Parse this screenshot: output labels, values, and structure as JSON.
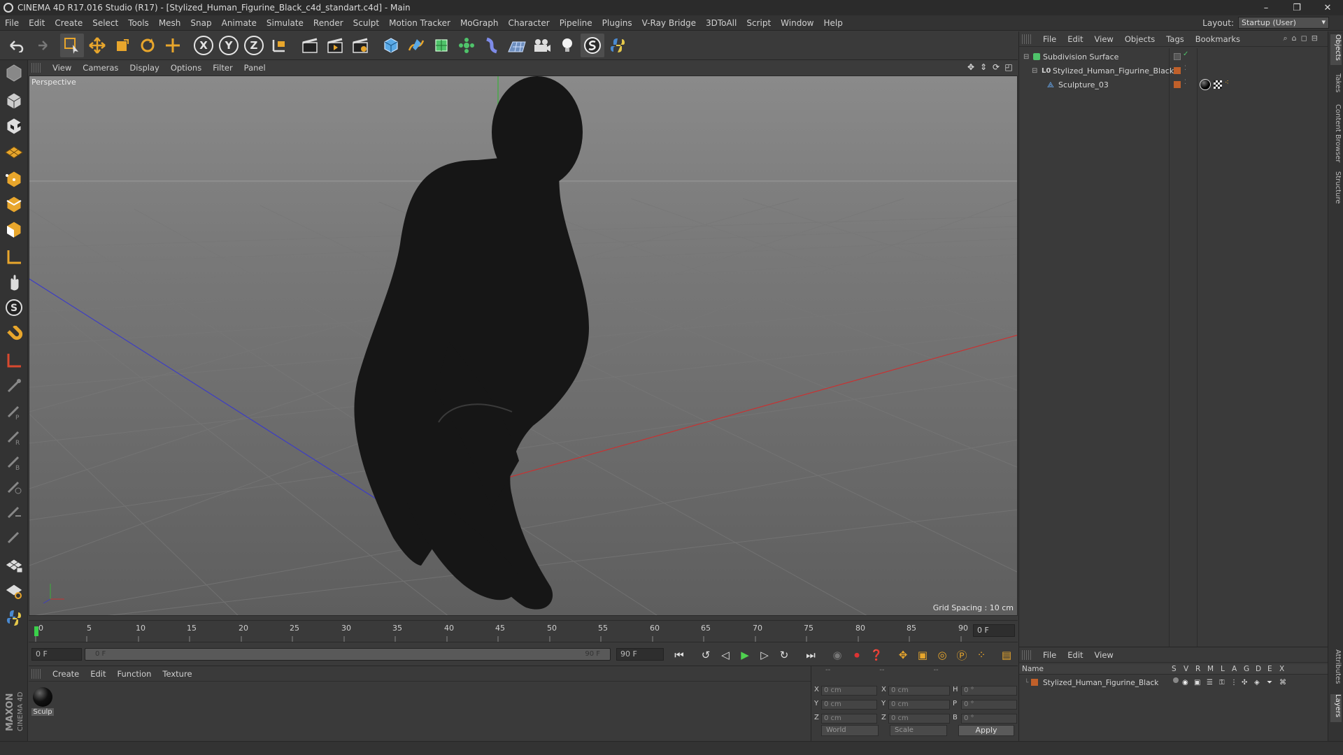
{
  "window": {
    "title": "CINEMA 4D R17.016 Studio (R17) - [Stylized_Human_Figurine_Black_c4d_standart.c4d] - Main",
    "controls": [
      "–",
      "❐",
      "✕"
    ]
  },
  "menubar": {
    "items": [
      "File",
      "Edit",
      "Create",
      "Select",
      "Tools",
      "Mesh",
      "Snap",
      "Animate",
      "Simulate",
      "Render",
      "Sculpt",
      "Motion Tracker",
      "MoGraph",
      "Character",
      "Pipeline",
      "Plugins",
      "V-Ray Bridge",
      "3DToAll",
      "Script",
      "Window",
      "Help"
    ],
    "layout_label": "Layout:",
    "layout_value": "Startup (User)"
  },
  "toolbar": {
    "axis_x": "X",
    "axis_y": "Y",
    "axis_z": "Z"
  },
  "viewport": {
    "menu": [
      "View",
      "Cameras",
      "Display",
      "Options",
      "Filter",
      "Panel"
    ],
    "camera_label": "Perspective",
    "grid_spacing": "Grid Spacing : 10 cm"
  },
  "timeline": {
    "ticks": [
      "0",
      "5",
      "10",
      "15",
      "20",
      "25",
      "30",
      "35",
      "40",
      "45",
      "50",
      "55",
      "60",
      "65",
      "70",
      "75",
      "80",
      "85",
      "90"
    ],
    "current_frame": "0 F"
  },
  "playbar": {
    "start_frame": "0 F",
    "slider_start": "0 F",
    "slider_end": "90 F",
    "end_frame": "90 F"
  },
  "material_panel": {
    "menu": [
      "Create",
      "Edit",
      "Function",
      "Texture"
    ],
    "material_name": "Sculp"
  },
  "coordinates": {
    "header": [
      "--",
      "--",
      "--"
    ],
    "rows": [
      {
        "a1": "X",
        "v1": "0 cm",
        "a2": "X",
        "v2": "0 cm",
        "a3": "H",
        "v3": "0 °"
      },
      {
        "a1": "Y",
        "v1": "0 cm",
        "a2": "Y",
        "v2": "0 cm",
        "a3": "P",
        "v3": "0 °"
      },
      {
        "a1": "Z",
        "v1": "0 cm",
        "a2": "Z",
        "v2": "0 cm",
        "a3": "B",
        "v3": "0 °"
      }
    ],
    "space": "World",
    "mode": "Scale",
    "apply": "Apply"
  },
  "object_manager": {
    "menu": [
      "File",
      "Edit",
      "View",
      "Objects",
      "Tags",
      "Bookmarks"
    ],
    "objects": [
      {
        "name": "Subdivision Surface",
        "level": 0,
        "icon_color": "#4fc36a"
      },
      {
        "name": "Stylized_Human_Figurine_Black",
        "level": 1,
        "icon_color": "#cfcfcf"
      },
      {
        "name": "Sculpture_03",
        "level": 2,
        "icon_color": "#6db3ff"
      }
    ]
  },
  "layer_manager": {
    "menu": [
      "File",
      "Edit",
      "View"
    ],
    "columns": [
      "Name",
      "S",
      "V",
      "R",
      "M",
      "L",
      "A",
      "G",
      "D",
      "E",
      "X"
    ],
    "layer_name": "Stylized_Human_Figurine_Black"
  },
  "side_tabs": [
    "Objects",
    "Takes",
    "Content Browser",
    "Structure"
  ],
  "side_tabs_bottom": [
    "Attributes",
    "Layers"
  ],
  "colors": {
    "accent_orange": "#e8a62c",
    "layer_orange": "#c0602a",
    "axis_x": "#c83232",
    "axis_y": "#3ab03a",
    "axis_z": "#3d3dc4"
  }
}
